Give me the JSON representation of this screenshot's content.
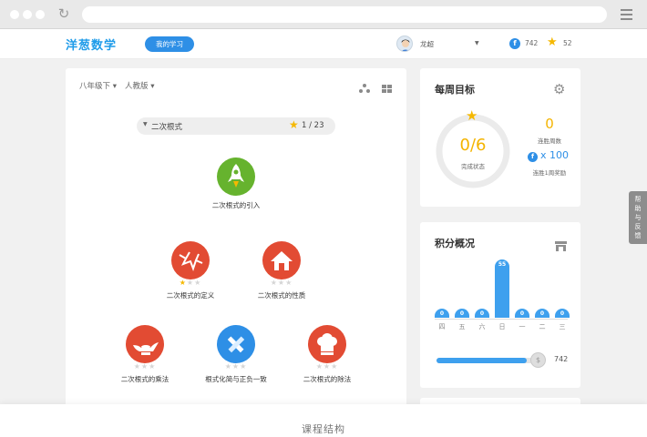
{
  "header": {
    "logo": "洋葱数学",
    "my_learning": "我的学习",
    "username": "龙超",
    "coins": "742",
    "stars": "52"
  },
  "course": {
    "grade_filter": "八年级下",
    "edition_filter": "人教版",
    "chapter": {
      "title": "二次根式",
      "progress": "1 / 23"
    },
    "topics": [
      {
        "label": "二次根式的引入",
        "icon": "rocket-icon",
        "color": "#66b32e",
        "stars_earned": null
      },
      {
        "label": "二次根式的定义",
        "icon": "crack-icon",
        "color": "#e24b33",
        "stars_earned": 1
      },
      {
        "label": "二次根式的性质",
        "icon": "house-icon",
        "color": "#e24b33",
        "stars_earned": 0
      },
      {
        "label": "二次根式的乘法",
        "icon": "magic-lamp-icon",
        "color": "#e24b33",
        "stars_earned": 0
      },
      {
        "label": "根式化简与正负一致",
        "icon": "pencil-ruler-icon",
        "color": "#2e8fe6",
        "stars_earned": 0
      },
      {
        "label": "二次根式的除法",
        "icon": "chef-hat-icon",
        "color": "#e24b33",
        "stars_earned": 0
      }
    ]
  },
  "weekly_goal": {
    "title": "每周目标",
    "progress_value": "0/6",
    "progress_fraction": 0,
    "progress_caption": "完成状态",
    "streak_weeks": "0",
    "streak_caption": "连胜周数",
    "reward_amount": "x 100",
    "reward_caption": "连胜1周奖励"
  },
  "points": {
    "title": "积分概况",
    "chart_data": {
      "type": "bar",
      "categories": [
        "四",
        "五",
        "六",
        "日",
        "一",
        "二",
        "三"
      ],
      "values": [
        0,
        0,
        0,
        55,
        0,
        0,
        0
      ],
      "ylim": [
        0,
        55
      ]
    },
    "balance": "742",
    "balance_fraction": 0.9
  },
  "help_tab": "帮助与反馈",
  "caption": "课程结构",
  "colors": {
    "brand_blue": "#2e8fe6",
    "gold": "#f4b400",
    "red": "#e24b33",
    "green": "#66b32e"
  }
}
